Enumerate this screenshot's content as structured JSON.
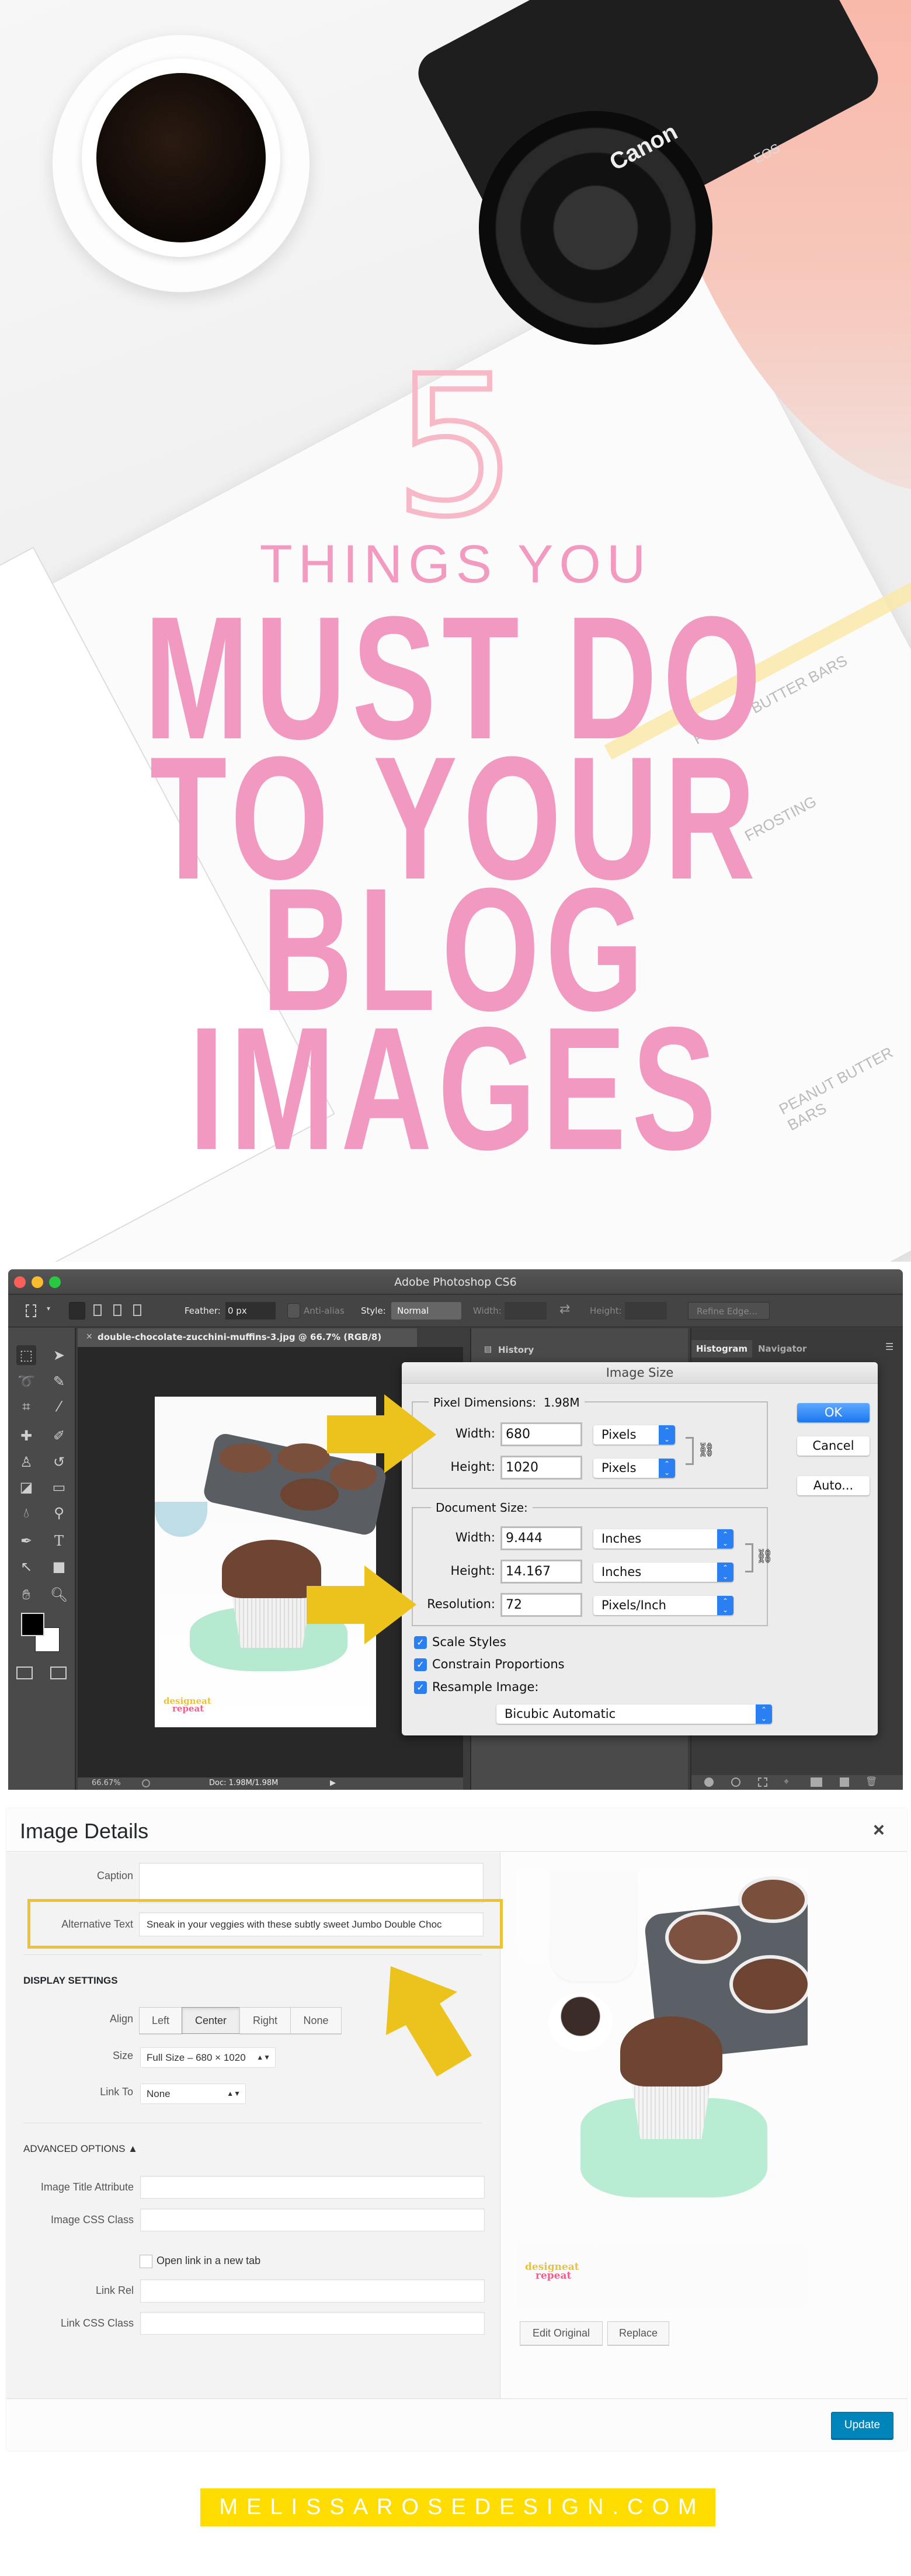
{
  "hero": {
    "number": "5",
    "subtitle": "THINGS YOU",
    "title_lines": [
      "MUST DO",
      "TO YOUR",
      "BLOG",
      "IMAGES"
    ],
    "camera_brand": "Canon",
    "camera_model": "EOS",
    "notebook_heading_1": "PEANUT BUTTER BARS",
    "notebook_heading_2": "PEANUT BUTTER BARS",
    "notebook_subheading": "FROSTING",
    "colors": {
      "title_pink": "#f299c1",
      "number_pink": "#f7b8c8"
    }
  },
  "photoshop": {
    "window_title": "Adobe Photoshop CS6",
    "options": {
      "feather_label": "Feather:",
      "feather_value": "0 px",
      "antialias_label": "Anti-alias",
      "style_label": "Style:",
      "style_value": "Normal",
      "width_label": "Width:",
      "height_label": "Height:",
      "refine_edge": "Refine Edge..."
    },
    "document_tab": "double-chocolate-zucchini-muffins-3.jpg @ 66.7% (RGB/8)",
    "history_panel": "History",
    "panel_tabs": [
      "Histogram",
      "Navigator"
    ],
    "status": {
      "zoom": "66.67%",
      "doc": "Doc: 1.98M/1.98M"
    },
    "watermark": {
      "line1": "designeat",
      "line2": "repeat"
    },
    "dialog": {
      "title": "Image Size",
      "pixel_dimensions_label": "Pixel Dimensions:",
      "pixel_dimensions_value": "1.98M",
      "pixel_width_label": "Width:",
      "pixel_width": "680",
      "pixel_width_unit": "Pixels",
      "pixel_height_label": "Height:",
      "pixel_height": "1020",
      "pixel_height_unit": "Pixels",
      "document_size_label": "Document Size:",
      "doc_width_label": "Width:",
      "doc_width": "9.444",
      "doc_width_unit": "Inches",
      "doc_height_label": "Height:",
      "doc_height": "14.167",
      "doc_height_unit": "Inches",
      "resolution_label": "Resolution:",
      "resolution": "72",
      "resolution_unit": "Pixels/Inch",
      "scale_styles": "Scale Styles",
      "constrain_proportions": "Constrain Proportions",
      "resample_image": "Resample Image:",
      "resample_method": "Bicubic Automatic",
      "checkboxes_checked": [
        true,
        true,
        true
      ],
      "ok": "OK",
      "cancel": "Cancel",
      "auto": "Auto..."
    },
    "arrow_color": "#ebc31c"
  },
  "image_details": {
    "title": "Image Details",
    "close": "×",
    "caption_label": "Caption",
    "caption_value": "",
    "alt_label": "Alternative Text",
    "alt_value": "Sneak in your veggies with these subtly sweet Jumbo Double Choc",
    "display_settings": "DISPLAY SETTINGS",
    "align_label": "Align",
    "align_options": [
      "Left",
      "Center",
      "Right",
      "None"
    ],
    "align_selected": "Center",
    "size_label": "Size",
    "size_value": "Full Size – 680 × 1020",
    "link_to_label": "Link To",
    "link_to_value": "None",
    "advanced_options": "ADVANCED OPTIONS ▲",
    "image_title_label": "Image Title Attribute",
    "image_css_label": "Image CSS Class",
    "open_new_tab": "Open link in a new tab",
    "link_rel_label": "Link Rel",
    "link_css_label": "Link CSS Class",
    "edit_original": "Edit Original",
    "replace": "Replace",
    "update": "Update",
    "highlight_color": "#eec333",
    "update_color": "#0085ba"
  },
  "footer": {
    "site": "MELISSAROSEDESIGN.COM",
    "bar_color": "#ffdd00"
  }
}
